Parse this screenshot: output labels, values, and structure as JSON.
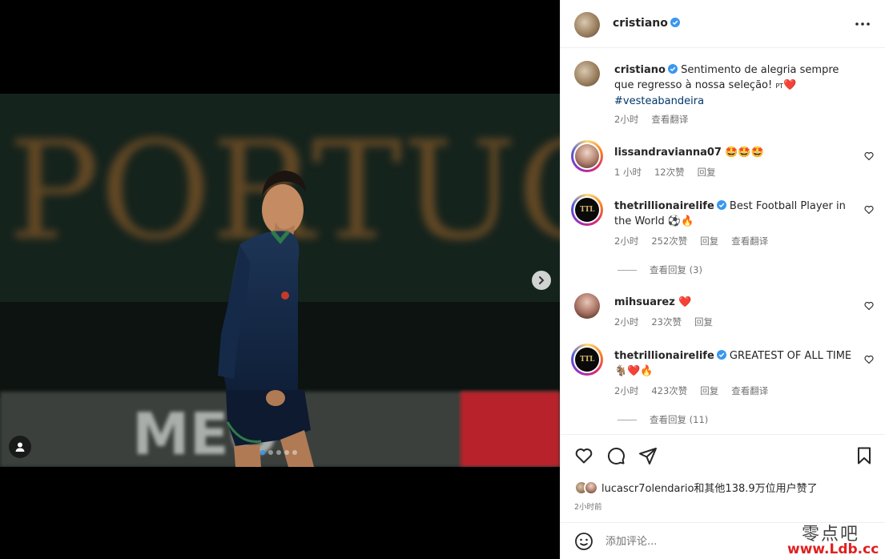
{
  "post": {
    "username": "cristiano",
    "caption": {
      "username": "cristiano",
      "text": "Sentimento de alegria sempre que regresso à nossa seleção!",
      "flag": "PT",
      "emoji": "❤️",
      "hashtag": "#vesteabandeira",
      "time": "2小时",
      "translate": "查看翻译"
    },
    "image": {
      "backdrop_text": "PORTUGAL",
      "banner_text": "MEO",
      "slide_count": 5,
      "active_slide": 1
    }
  },
  "comments": [
    {
      "username": "lissandravianna07",
      "text": "🤩🤩🤩",
      "time": "1 小时",
      "likes": "12次赞",
      "reply": "回复"
    },
    {
      "username": "thetrillionairelife",
      "verified": true,
      "text": "Best Football Player in the World ⚽🔥",
      "time": "2小时",
      "likes": "252次赞",
      "reply": "回复",
      "translate": "查看翻译",
      "view_replies": "查看回复 (3)"
    },
    {
      "username": "mihsuarez",
      "text": "❤️",
      "time": "2小时",
      "likes": "23次赞",
      "reply": "回复"
    },
    {
      "username": "thetrillionairelife",
      "verified": true,
      "text": "GREATEST OF ALL TIME 🐐❤️🔥",
      "time": "2小时",
      "likes": "423次赞",
      "reply": "回复",
      "translate": "查看翻译",
      "view_replies": "查看回复 (11)"
    }
  ],
  "likes": {
    "text": "lucascr7olendario和其他138.9万位用户赞了"
  },
  "posted_ago": "2小时前",
  "comment_input": {
    "placeholder": "添加评论..."
  },
  "watermark": {
    "line1": "零点吧",
    "line2": "www.Ldb.cc"
  },
  "icons": {
    "header_more": "more-horizontal-icon",
    "like": "heart-icon",
    "comment": "comment-icon",
    "share": "send-icon",
    "save": "bookmark-icon",
    "emoji": "emoji-icon",
    "next": "chevron-right-icon",
    "tags": "user-tag-icon"
  },
  "colors": {
    "verified": "#3897f0",
    "link": "#00376b",
    "muted": "#737373"
  }
}
